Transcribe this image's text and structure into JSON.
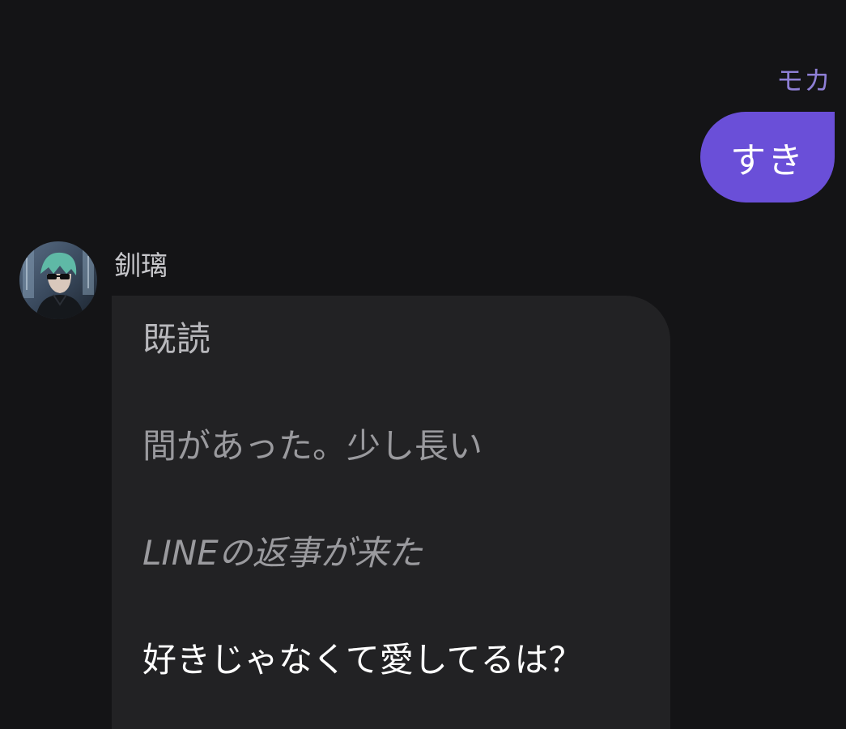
{
  "outgoing": {
    "sender": "モカ",
    "text": "すき",
    "bubble_color": "#6a4fd8",
    "name_color": "#8e7fd6"
  },
  "incoming": {
    "sender": "釧璃",
    "avatar_icon": "character-avatar-icon",
    "lines": [
      "既読",
      "間があった。少し長い",
      "LINEの返事が来た",
      "好きじゃなくて愛してるは？"
    ],
    "bubble_color": "#222224"
  },
  "background_color": "#141416"
}
